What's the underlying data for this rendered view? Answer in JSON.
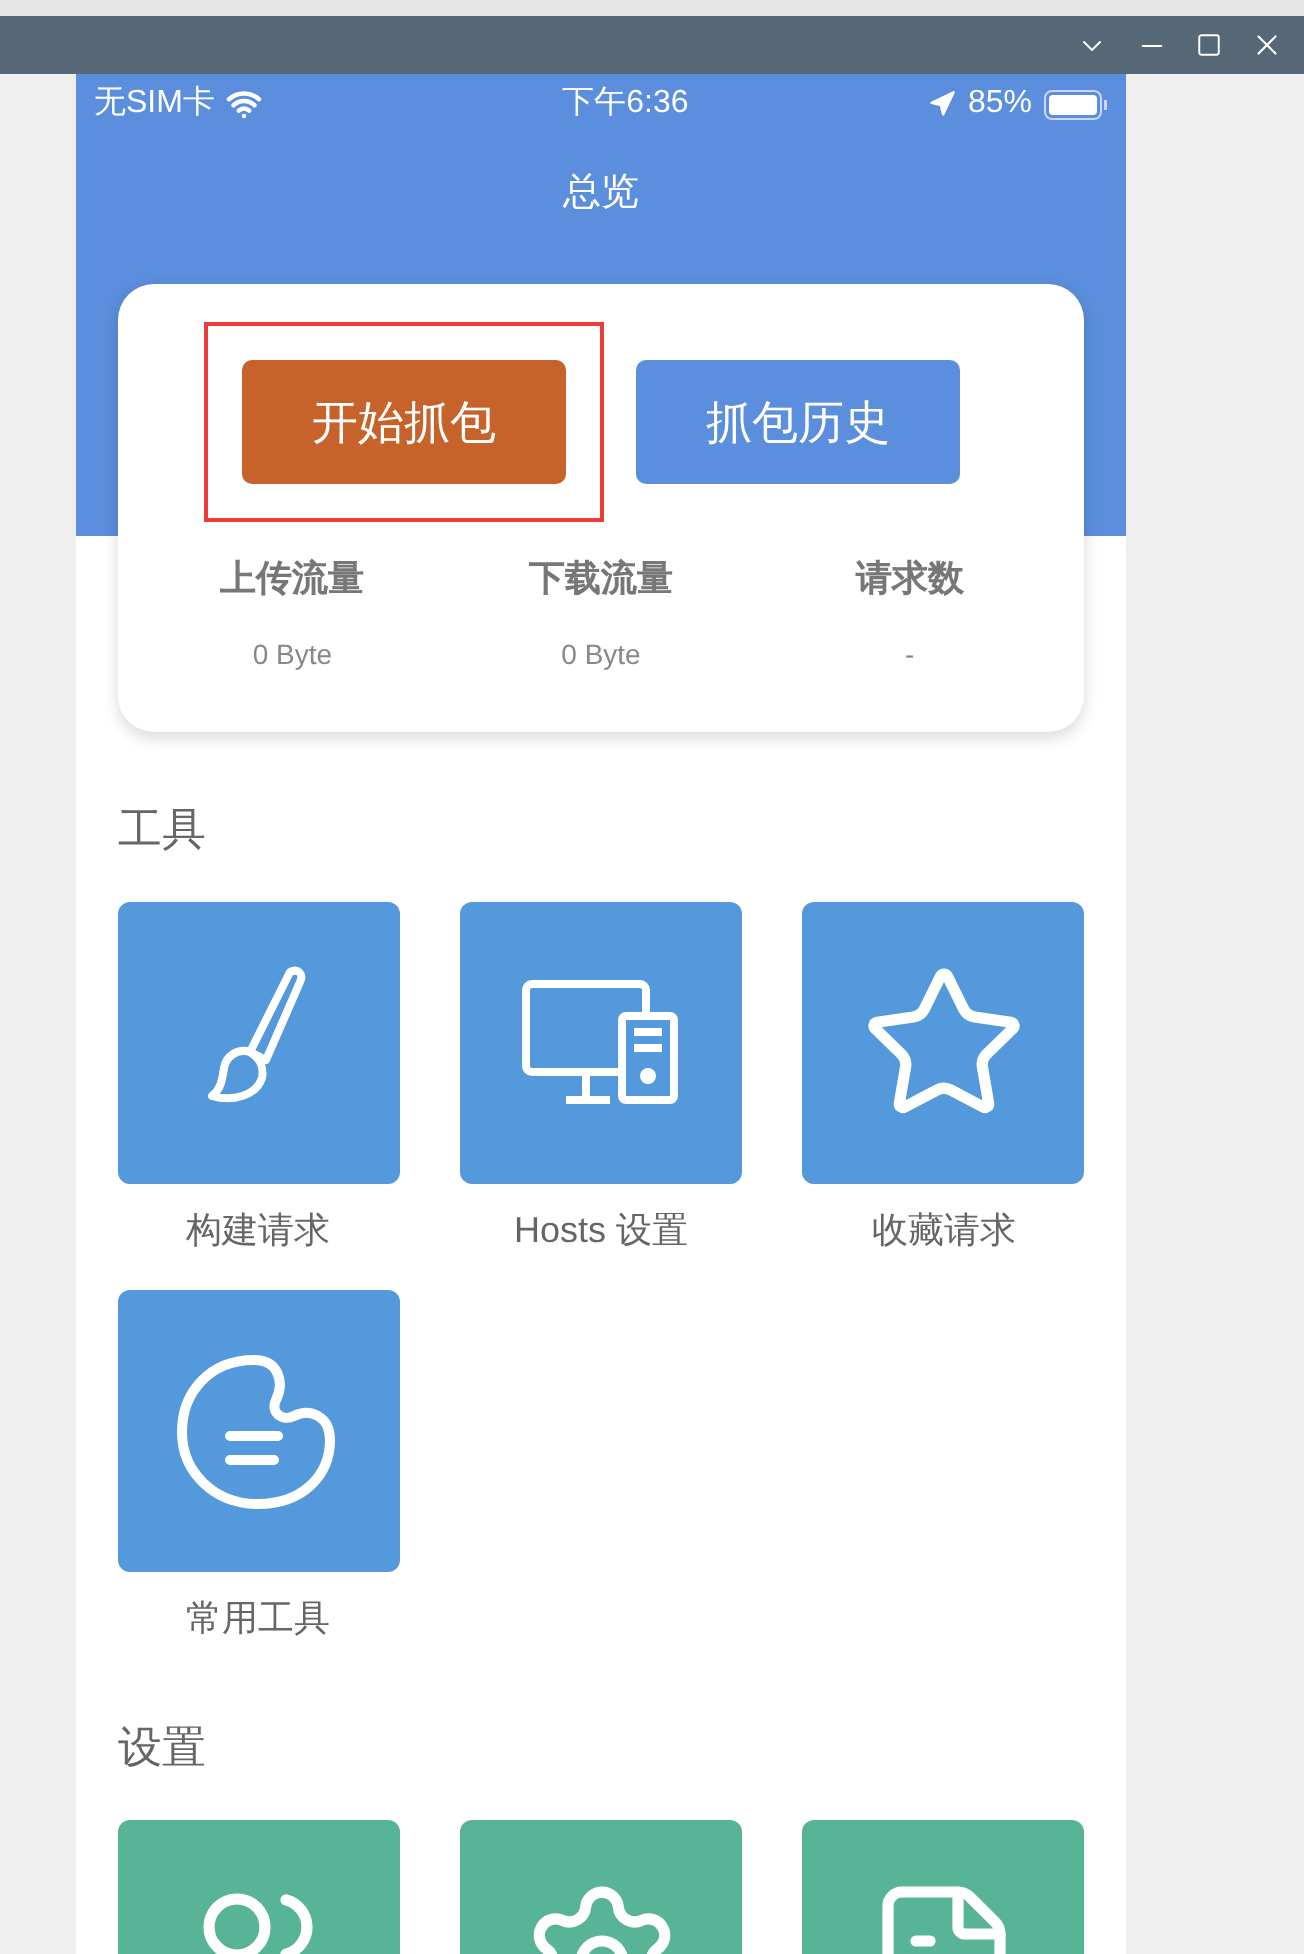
{
  "status_bar": {
    "carrier": "无SIM卡",
    "time": "下午6:36",
    "battery": "85%"
  },
  "nav": {
    "title": "总览"
  },
  "actions": [
    {
      "label": "开始抓包",
      "kind": "primary",
      "highlighted": true
    },
    {
      "label": "抓包历史",
      "kind": "secondary",
      "highlighted": false
    }
  ],
  "stats": [
    {
      "label": "上传流量",
      "value": "0 Byte"
    },
    {
      "label": "下载流量",
      "value": "0 Byte"
    },
    {
      "label": "请求数",
      "value": "-"
    }
  ],
  "sections": [
    {
      "title": "工具",
      "color": "#5499dc",
      "items": [
        {
          "label": "构建请求",
          "kind": "brush"
        },
        {
          "label": "Hosts 设置",
          "kind": "computer"
        },
        {
          "label": "收藏请求",
          "kind": "star"
        },
        {
          "label": "常用工具",
          "kind": "palette"
        }
      ]
    },
    {
      "title": "设置",
      "color": "#58b497",
      "items": [
        {
          "kind": "people"
        },
        {
          "kind": "gear"
        },
        {
          "kind": "document"
        }
      ]
    }
  ]
}
